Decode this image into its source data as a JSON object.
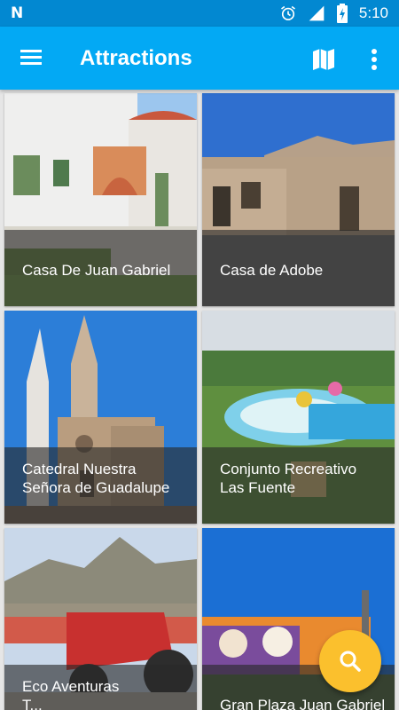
{
  "status_bar": {
    "time": "5:10"
  },
  "app_bar": {
    "title": "Attractions"
  },
  "cards": [
    {
      "label": "Casa De Juan Gabriel"
    },
    {
      "label": "Casa de Adobe"
    },
    {
      "label": "Catedral Nuestra\nSeñora de Guadalupe"
    },
    {
      "label": "Conjunto Recreativo\nLas Fuente"
    },
    {
      "label": "Eco Aventuras\nT..."
    },
    {
      "label": "Gran Plaza Juan Gabriel"
    }
  ],
  "colors": {
    "primary": "#03a9f4",
    "primary_dark": "#0288d1",
    "accent": "#fbc02d"
  },
  "icons": [
    "n-logo",
    "alarm-icon",
    "signal-icon",
    "battery-icon",
    "menu-icon",
    "map-icon",
    "more-vert-icon",
    "search-icon"
  ]
}
